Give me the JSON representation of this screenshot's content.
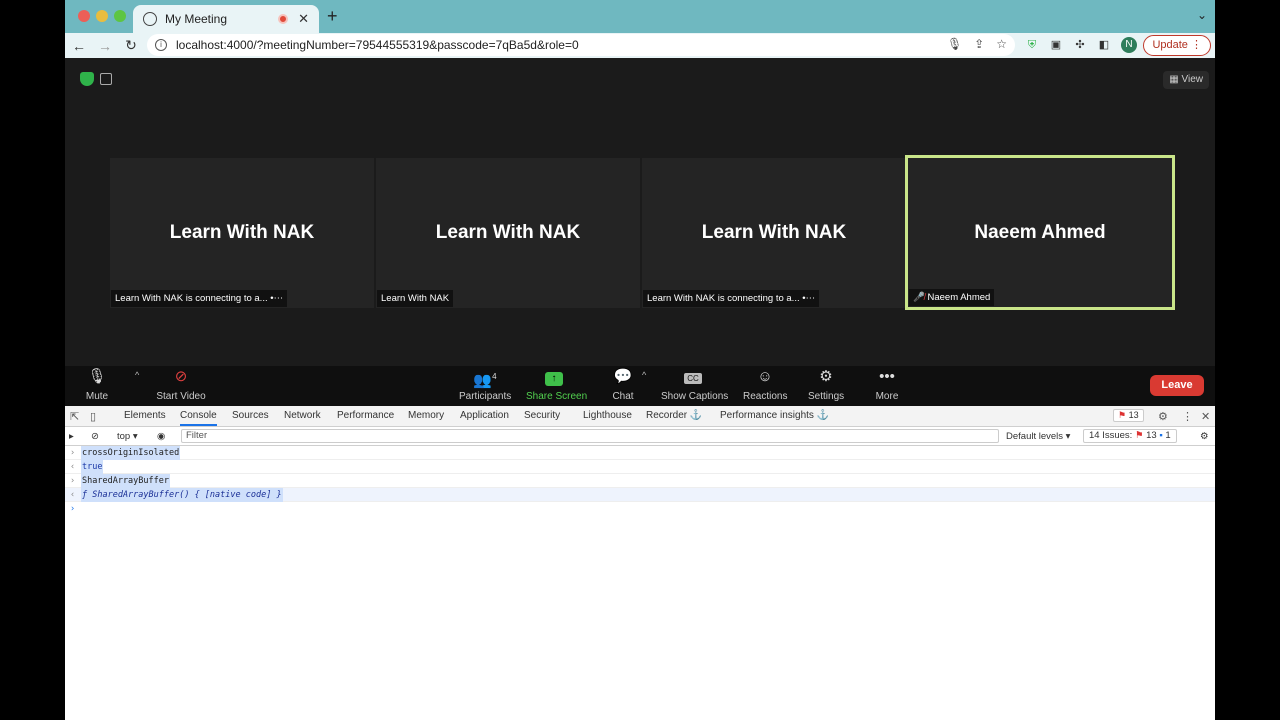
{
  "browser": {
    "tab_title": "My Meeting",
    "url": "localhost:4000/?meetingNumber=79544555319&passcode=7qBa5d&role=0",
    "update_label": "Update",
    "profile_initial": "N",
    "accent": "#6fb8c0"
  },
  "meeting": {
    "view_label": "View",
    "tiles": [
      {
        "name": "Learn With NAK",
        "label": "Learn With NAK is connecting to a... •⋯"
      },
      {
        "name": "Learn With NAK",
        "label": "Learn With NAK"
      },
      {
        "name": "Learn With NAK",
        "label": "Learn With NAK is connecting to a... •⋯"
      },
      {
        "name": "Naeem Ahmed",
        "label": "Naeem Ahmed"
      }
    ],
    "controls": {
      "mute": "Mute",
      "start_video": "Start Video",
      "participants": "Participants",
      "participants_count": "4",
      "share_screen": "Share Screen",
      "chat": "Chat",
      "show_captions": "Show Captions",
      "reactions": "Reactions",
      "settings": "Settings",
      "more": "More",
      "leave": "Leave"
    }
  },
  "devtools": {
    "tabs": [
      "Elements",
      "Console",
      "Sources",
      "Network",
      "Performance",
      "Memory",
      "Application",
      "Security",
      "Lighthouse",
      "Recorder ⚓",
      "Performance insights ⚓"
    ],
    "error_count": "13",
    "context": "top",
    "filter_placeholder": "Filter",
    "levels": "Default levels",
    "issues_label": "14 Issues:",
    "issues_errors": "13",
    "issues_info": "1",
    "console": [
      {
        "type": "in",
        "text": "crossOriginIsolated"
      },
      {
        "type": "out",
        "text": "true"
      },
      {
        "type": "in",
        "text": "SharedArrayBuffer"
      },
      {
        "type": "fn",
        "text": "ƒ SharedArrayBuffer() { [native code] }"
      }
    ]
  }
}
